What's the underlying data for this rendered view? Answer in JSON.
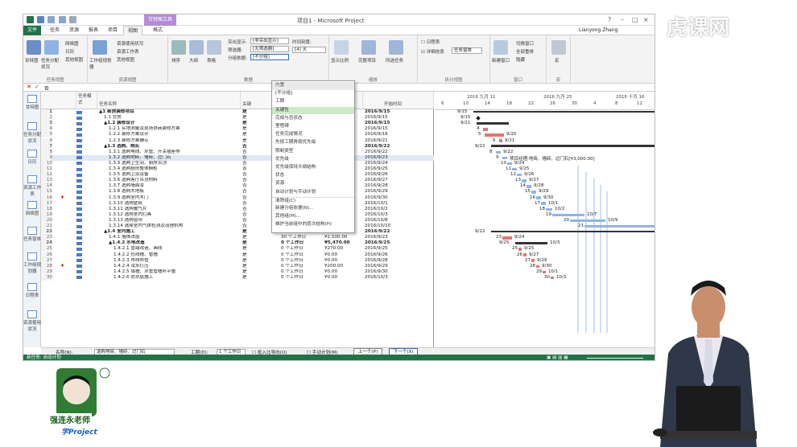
{
  "window": {
    "title": "项目1 - Microsoft Project",
    "tool_tab": "甘特图工具",
    "user": "Lianyong Zhang"
  },
  "tabs": [
    "文件",
    "任务",
    "资源",
    "报表",
    "项目",
    "视图",
    "格式"
  ],
  "ribbon": {
    "groups": [
      "任务视图",
      "资源视图",
      "数据",
      "缩放",
      "拆分视图",
      "窗口",
      "宏"
    ],
    "buttons": {
      "gantt": "甘特图",
      "task_usage": "任务分配状况",
      "network": "网络图",
      "calendar": "日历",
      "other_views": "其他视图",
      "team_planner": "工作组规划器",
      "res_usage": "资源使用状况",
      "res_sheet": "资源工作表",
      "other_views2": "其他视图",
      "sort": "排序",
      "outline": "大纲",
      "tables": "表格",
      "highlight_label": "突出显示:",
      "highlight_value": "[非突出显示]",
      "filter_label": "筛选器:",
      "filter_value": "[无筛选器]",
      "group_label": "分组依据:",
      "group_value": "[不分组]",
      "timescale_label": "时间刻度:",
      "timescale_value": "[4] 天",
      "zoom_entire": "显示比例",
      "complete": "完整项目",
      "selected": "所选任务",
      "timeline": "日程表",
      "details": "详细信息",
      "details_value": "任务窗体",
      "new_window": "新建窗口",
      "switch": "切换窗口",
      "arrange": "全部重排",
      "hide": "隐藏",
      "macros": "宏"
    }
  },
  "formula_bar": {
    "value": "否"
  },
  "left_nav": [
    "甘特图",
    "任务分配状况",
    "日历",
    "资源工作表",
    "网络图",
    "任务窗体",
    "工作组规划器",
    "日程表",
    "资源使用状况"
  ],
  "grid": {
    "headers": [
      "任务模式",
      "任务名称",
      "关键",
      "工期",
      "开始时间"
    ],
    "rows": [
      {
        "n": "1",
        "name": "▲1 新房装修项目",
        "crit": "是",
        "dur": "97 个工作日",
        "cost": "",
        "start": "2016/9/15",
        "sum": true,
        "indent": 0
      },
      {
        "n": "2",
        "name": "1.1 交房",
        "crit": "是",
        "dur": "0 个工作日",
        "cost": "",
        "start": "2016/9/15",
        "sum": false,
        "indent": 1
      },
      {
        "n": "3",
        "name": "▲1.2 装修设计",
        "crit": "是",
        "dur": "7 个工作日",
        "cost": "",
        "start": "2016/9/15",
        "sum": true,
        "indent": 1
      },
      {
        "n": "4",
        "name": "1.2.1 实地测量及现场协商装修方案",
        "crit": "是",
        "dur": "1 个工作日",
        "cost": "",
        "start": "2016/9/15",
        "sum": false,
        "indent": 2
      },
      {
        "n": "5",
        "name": "1.2.2 装修方案设计",
        "crit": "是",
        "dur": "5 个工作日",
        "cost": "",
        "start": "2016/9/16",
        "sum": false,
        "indent": 2
      },
      {
        "n": "6",
        "name": "1.2.3 装修方案确认",
        "crit": "是",
        "dur": "1 个工作日",
        "cost": "",
        "start": "2016/9/21",
        "sum": false,
        "indent": 2
      },
      {
        "n": "7",
        "name": "▲1.3 选购、购买",
        "crit": "否",
        "dur": "28 个工作日",
        "cost": "",
        "start": "2016/9/22",
        "sum": true,
        "indent": 1
      },
      {
        "n": "8",
        "name": "1.3.1 选购电线、水管、开关插座等",
        "crit": "否",
        "dur": "1 个工作日",
        "cost": "",
        "start": "2016/9/22",
        "sum": false,
        "indent": 2
      },
      {
        "n": "9",
        "name": "1.3.2 选购地砖、墙砖、过门石",
        "crit": "否",
        "dur": "1 个工作日",
        "cost": "",
        "start": "2016/9/23",
        "sum": false,
        "indent": 2
      },
      {
        "n": "10",
        "name": "1.3.3 选购卫生间、厨房吊顶",
        "crit": "否",
        "dur": "1 个工作日",
        "cost": "",
        "start": "2016/9/24",
        "sum": false,
        "indent": 2
      },
      {
        "n": "11",
        "name": "1.3.4 选购厨房整体橱柜",
        "crit": "否",
        "dur": "1 个工作日",
        "cost": "",
        "start": "2016/9/25",
        "sum": false,
        "indent": 2
      },
      {
        "n": "12",
        "name": "1.3.5 选购卫浴设备",
        "crit": "否",
        "dur": "1 个工作日",
        "cost": "",
        "start": "2016/9/26",
        "sum": false,
        "indent": 2
      },
      {
        "n": "13",
        "name": "1.3.6 选购客厅吊顶材料",
        "crit": "否",
        "dur": "1 个工作日",
        "cost": "",
        "start": "2016/9/27",
        "sum": false,
        "indent": 2
      },
      {
        "n": "14",
        "name": "1.3.7 选购墙面漆",
        "crit": "否",
        "dur": "1 个工作日",
        "cost": "",
        "start": "2016/9/28",
        "sum": false,
        "indent": 2
      },
      {
        "n": "15",
        "name": "1.3.8 选购木地板",
        "crit": "否",
        "dur": "1 个工作日",
        "cost": "",
        "start": "2016/9/29",
        "sum": false,
        "indent": 2
      },
      {
        "n": "16",
        "name": "1.3.9 选购室内木门",
        "crit": "否",
        "dur": "1 个工作日",
        "cost": "",
        "start": "2016/9/30",
        "sum": false,
        "indent": 2
      },
      {
        "n": "17",
        "name": "1.3.10 选购壁纸",
        "crit": "否",
        "dur": "30 个工作日",
        "cost": "¥1,050.00",
        "start": "2016/10/1",
        "sum": false,
        "indent": 2
      },
      {
        "n": "18",
        "name": "1.3.11 选购暖气片",
        "crit": "否",
        "dur": "30 个工作日",
        "cost": "¥1,250.00",
        "start": "2016/10/2",
        "sum": false,
        "indent": 2
      },
      {
        "n": "19",
        "name": "1.3.12 选购室内灯具",
        "crit": "否",
        "dur": "30 个工作日",
        "cost": "¥3,250.00",
        "start": "2016/10/3",
        "sum": false,
        "indent": 2
      },
      {
        "n": "20",
        "name": "1.3.13 选购窗帘",
        "crit": "否",
        "dur": "30 个工作日",
        "cost": "¥1,300.00",
        "start": "2016/10/8",
        "sum": false,
        "indent": 2
      },
      {
        "n": "21",
        "name": "1.3.14 选择室内气体检测及治理机构",
        "crit": "否",
        "dur": "59 个工作日",
        "cost": "¥250.00",
        "start": "2016/10/10",
        "sum": false,
        "indent": 2
      },
      {
        "n": "22",
        "name": "▲1.4 室内施工",
        "crit": "是",
        "dur": "0 个工作日",
        "cost": "¥20,620.00",
        "start": "2016/9/22",
        "sum": true,
        "indent": 1
      },
      {
        "n": "23",
        "name": "1.4.1 墙体改造",
        "crit": "是",
        "dur": "30 个工作日",
        "cost": "¥2,500.00",
        "start": "2016/9/23",
        "sum": false,
        "indent": 2
      },
      {
        "n": "24",
        "name": "▲1.4.2 水电改造",
        "crit": "是",
        "dur": "0 个工作日",
        "cost": "¥5,470.00",
        "start": "2016/9/25",
        "sum": true,
        "indent": 2
      },
      {
        "n": "25",
        "name": "1.4.2.1 管路改造、画线",
        "crit": "是",
        "dur": "0 个工作日",
        "cost": "¥270.00",
        "start": "2016/9/25",
        "sum": false,
        "indent": 3
      },
      {
        "n": "26",
        "name": "1.4.2.2 挖线槽、管槽",
        "crit": "是",
        "dur": "0 个工作日",
        "cost": "¥0.00",
        "start": "2016/9/26",
        "sum": false,
        "indent": 3
      },
      {
        "n": "27",
        "name": "1.4.2.3 布线布管",
        "crit": "是",
        "dur": "0 个工作日",
        "cost": "¥0.00",
        "start": "2016/9/28",
        "sum": false,
        "indent": 3
      },
      {
        "n": "28",
        "name": "1.4.2.4 试水打压",
        "crit": "是",
        "dur": "0 个工作日",
        "cost": "¥200.00",
        "start": "2016/9/29",
        "sum": false,
        "indent": 3
      },
      {
        "n": "29",
        "name": "1.4.2.5 填槽、水管管槽补平整",
        "crit": "是",
        "dur": "0 个工作日",
        "cost": "¥0.00",
        "start": "2016/9/30",
        "sum": false,
        "indent": 3
      },
      {
        "n": "30",
        "name": "1.4.2.6 防水层施工",
        "crit": "是",
        "dur": "0 个工作日",
        "cost": "¥0.00",
        "start": "2016/10/3",
        "sum": false,
        "indent": 3
      }
    ]
  },
  "dropdown": {
    "items": [
      "内置",
      "[不分组]",
      "工期",
      "关键性",
      "完成与否状态",
      "里程碑",
      "任务完成情况",
      "先按工期再按优先级",
      "限制类型",
      "优先级",
      "优先级保持大纲结构",
      "状态",
      "资源",
      "自动计划与手动计划",
      "清除组(C)",
      "新建分组依据(N)...",
      "其他组(M)...",
      "维护当前组中的层次结构(H)"
    ]
  },
  "gantt": {
    "months": [
      "2016 九月 11",
      "2016 九月 25",
      "2016 十月 16"
    ],
    "days": [
      "6",
      "10",
      "14",
      "18",
      "22",
      "26",
      "30",
      "4",
      "8",
      "12"
    ],
    "labels": [
      {
        "row": 0,
        "text": "9/15",
        "side": "left"
      },
      {
        "row": 1,
        "text": "9/15"
      },
      {
        "row": 2,
        "text": "9/21"
      },
      {
        "row": 3,
        "text": "4"
      },
      {
        "row": 4,
        "text": "5",
        "right": "9/20"
      },
      {
        "row": 5,
        "text": "6",
        "right": "9/21"
      },
      {
        "row": 6,
        "text": "9/22"
      },
      {
        "row": 7,
        "text": "8",
        "right": "9/22"
      },
      {
        "row": 8,
        "text": "9",
        "right": "项目经理;地砖、墙砖、过门石[¥3,000.00]"
      },
      {
        "row": 9,
        "text": "10",
        "right": "9/24"
      },
      {
        "row": 10,
        "text": "11",
        "right": "9/25"
      },
      {
        "row": 11,
        "text": "12",
        "right": "9/26"
      },
      {
        "row": 12,
        "text": "13",
        "right": "9/27"
      },
      {
        "row": 13,
        "text": "14",
        "right": "9/28"
      },
      {
        "row": 14,
        "text": "15",
        "right": "9/29"
      },
      {
        "row": 15,
        "text": "16",
        "right": "9/30"
      },
      {
        "row": 16,
        "text": "17",
        "right": "10/1"
      },
      {
        "row": 17,
        "text": "18",
        "right": "10/2"
      },
      {
        "row": 18,
        "text": "19",
        "right": "10/7"
      },
      {
        "row": 19,
        "text": "20",
        "right": "10/9"
      },
      {
        "row": 20,
        "text": "21"
      },
      {
        "row": 21,
        "text": "9/22"
      },
      {
        "row": 22,
        "text": "23",
        "right": "9/24"
      },
      {
        "row": 23,
        "text": "9/25",
        "right": "10/3"
      },
      {
        "row": 24,
        "text": "25",
        "right": "9/25"
      },
      {
        "row": 25,
        "text": "26",
        "right": "9/27"
      },
      {
        "row": 26,
        "text": "27",
        "right": "9/29"
      },
      {
        "row": 27,
        "text": "28",
        "right": "9/30"
      },
      {
        "row": 28,
        "text": "29",
        "right": "10/1"
      },
      {
        "row": 29,
        "text": "30",
        "right": "10/3"
      }
    ]
  },
  "task_form": {
    "name_label": "名称(N):",
    "name_value": "选购地砖、墙砖、过门石",
    "duration_label": "工期(D):",
    "duration_value": "1 个工作日",
    "effort": "投入比导向(O)",
    "manual": "手动计划(M)",
    "prev": "上一个(P)",
    "next": "下一个(X)"
  },
  "status": {
    "text": "新任务: 自动计划"
  },
  "logo": {
    "line1": "强连永老师",
    "line2": "学Project"
  },
  "watermark": "虎课网"
}
